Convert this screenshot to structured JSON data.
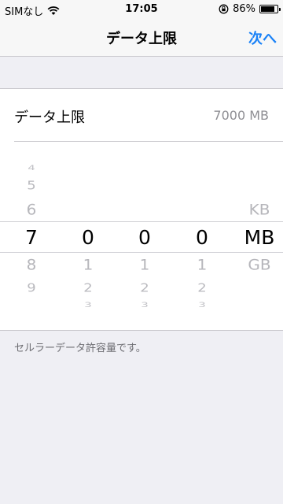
{
  "status_bar": {
    "carrier": "SIMなし",
    "time": "17:05",
    "battery": "86%",
    "battery_level": 0.86
  },
  "nav": {
    "title": "データ上限",
    "next_label": "次へ"
  },
  "limit_row": {
    "label": "データ上限",
    "value": "7000 MB"
  },
  "picker": {
    "digit_columns": [
      {
        "items": [
          "4",
          "5",
          "6",
          "7",
          "8",
          "9"
        ],
        "selected": "7"
      },
      {
        "items": [
          "0",
          "1",
          "2",
          "3"
        ],
        "selected": "0"
      },
      {
        "items": [
          "0",
          "1",
          "2",
          "3"
        ],
        "selected": "0"
      },
      {
        "items": [
          "0",
          "1",
          "2",
          "3"
        ],
        "selected": "0"
      }
    ],
    "units": {
      "items": [
        "KB",
        "MB",
        "GB"
      ],
      "selected": "MB"
    }
  },
  "footer_note": "セルラーデータ許容量です。",
  "colors": {
    "accent": "#1a82f7",
    "background": "#efeff4",
    "secondary_text": "#8e8e93"
  },
  "icons": [
    "wifi-icon",
    "rotation-lock-icon",
    "battery-icon"
  ]
}
